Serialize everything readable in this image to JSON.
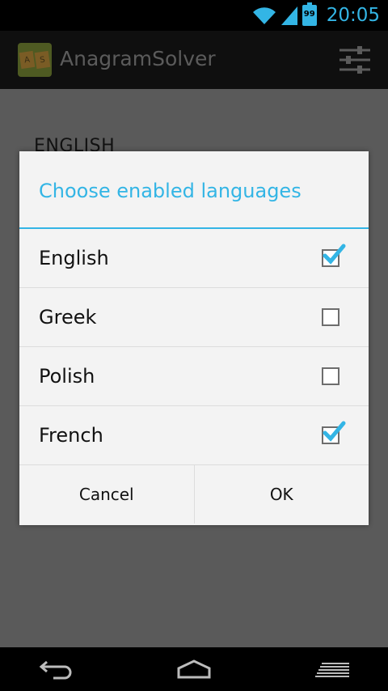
{
  "status_bar": {
    "battery_level": "99",
    "time": "20:05",
    "accent_color": "#33b5e5"
  },
  "action_bar": {
    "app_title": "AnagramSolver",
    "logo_letters": [
      "A",
      "S"
    ],
    "settings_icon": "sliders-icon"
  },
  "background": {
    "heading": "ENGLISH"
  },
  "dialog": {
    "title": "Choose enabled languages",
    "options": [
      {
        "label": "English",
        "checked": true
      },
      {
        "label": "Greek",
        "checked": false
      },
      {
        "label": "Polish",
        "checked": false
      },
      {
        "label": "French",
        "checked": true
      }
    ],
    "cancel_label": "Cancel",
    "ok_label": "OK"
  },
  "nav_bar": {
    "icons": [
      "back-icon",
      "home-icon",
      "recent-apps-icon"
    ]
  }
}
